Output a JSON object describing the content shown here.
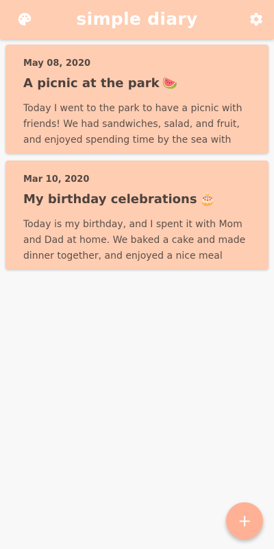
{
  "app_bar": {
    "title": "simple diary",
    "left_icon": "palette-icon",
    "right_icon": "gear-icon",
    "background": "#ffcdb2"
  },
  "entries": [
    {
      "date": "May 08, 2020",
      "title": "A picnic at the park",
      "emoji": "🍉",
      "body": "Today I went to the park to have a picnic with friends! We had sandwiches, salad, and fruit, and enjoyed spending time by the sea with each"
    },
    {
      "date": "Mar 10, 2020",
      "title": "My birthday celebrations",
      "emoji": "🎂",
      "body": "Today is my birthday, and I spent it with Mom and Dad at home. We baked a cake and made dinner together, and enjoyed a nice meal"
    }
  ],
  "fab": {
    "icon": "plus-icon",
    "label": "+",
    "color": "#ffb196"
  }
}
